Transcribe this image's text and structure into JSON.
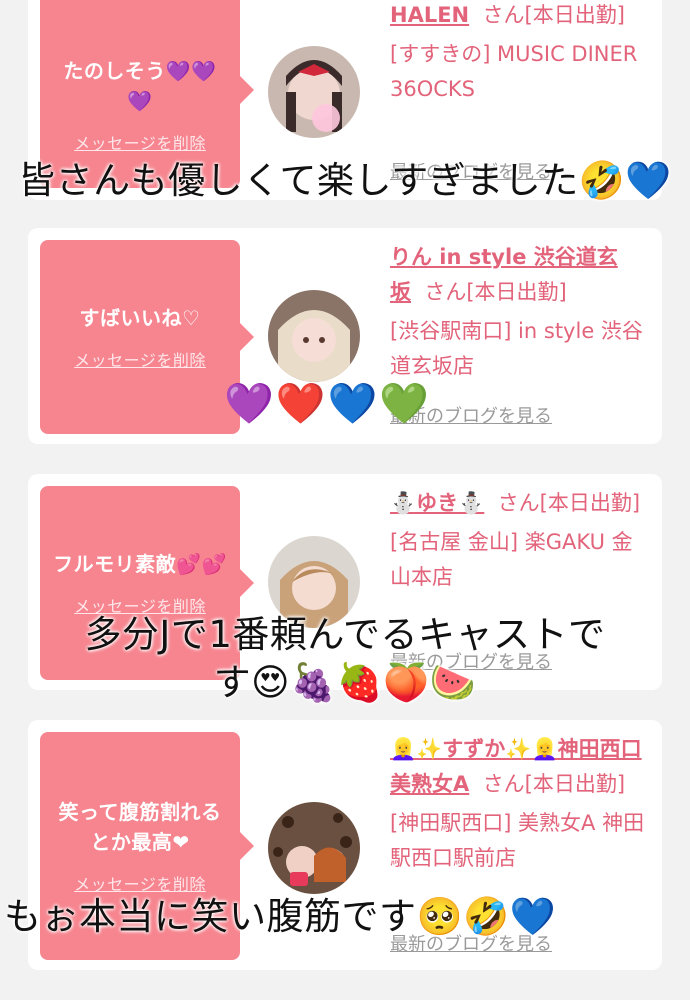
{
  "cards": [
    {
      "message": "たのしそう💜💜💜",
      "delete_label": "メッセージを削除",
      "cast_name": "HALEN",
      "cast_suffix": "さん[本日出勤]",
      "shop_area": "[すすきの] MUSIC DINER 36OCKS",
      "latest_blog": "最新のブログを見る"
    },
    {
      "message": "すばいいね♡",
      "delete_label": "メッセージを削除",
      "cast_name": "りん in style 渋谷道玄坂",
      "cast_suffix": "さん[本日出勤]",
      "shop_area": "[渋谷駅南口] in style 渋谷道玄坂店",
      "latest_blog": "最新のブログを見る"
    },
    {
      "message": "フルモリ素敵💕💕",
      "delete_label": "メッセージを削除",
      "cast_name": "⛄ゆき⛄",
      "cast_suffix": "さん[本日出勤]",
      "shop_area": "[名古屋 金山] 楽GAKU 金山本店",
      "latest_blog": "最新のブログを見る"
    },
    {
      "message": "笑って腹筋割れるとか最高❤",
      "delete_label": "メッセージを削除",
      "cast_name": "👱‍♀️✨すずか✨👱‍♀️神田西口美熟女A",
      "cast_suffix": "さん[本日出勤]",
      "shop_area": "[神田駅西口] 美熟女A 神田駅西口駅前店",
      "latest_blog": "最新のブログを見る"
    }
  ],
  "overlays": {
    "caption_1": "皆さんも優しくて楽しすぎました🤣💙",
    "emoji_hearts": "💜❤️💙💚",
    "caption_2_line1": "多分Jで1番頼んでるキャストで",
    "caption_2_line2": "す😍🍇🍓🍑🍉",
    "caption_3": "もぉ本当に笑い腹筋です🥺🤣💙"
  }
}
